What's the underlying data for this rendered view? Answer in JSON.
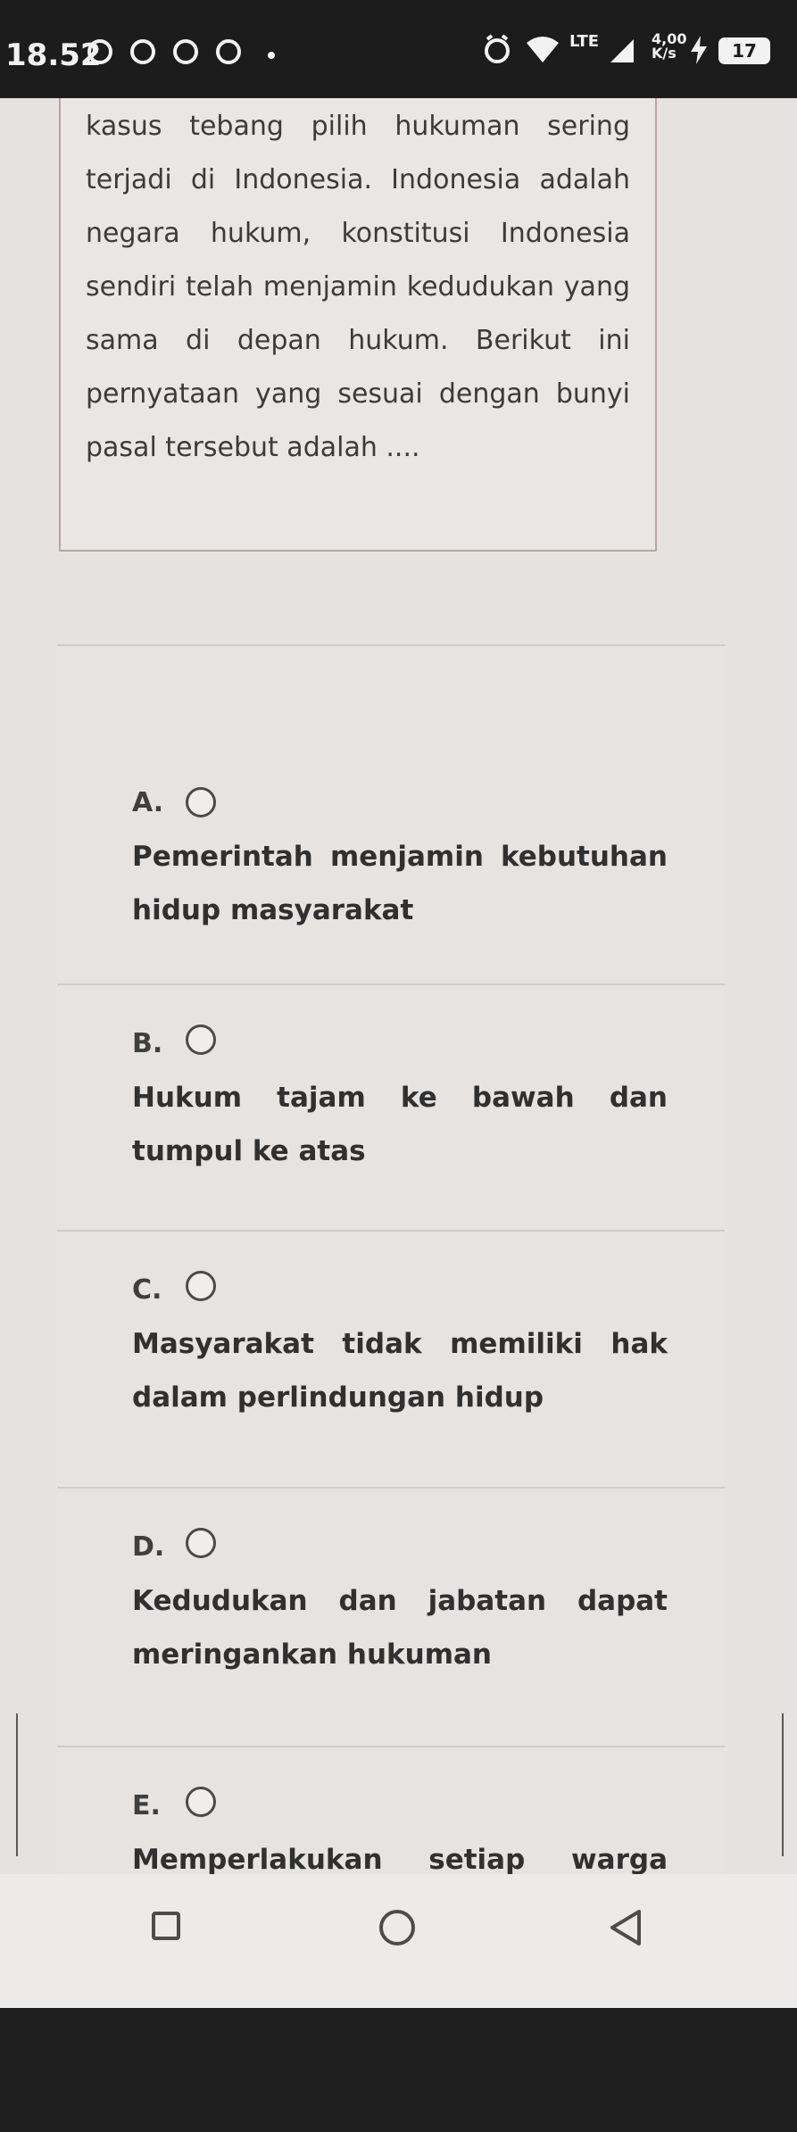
{
  "status_bar": {
    "time": "18.52",
    "battery": "17",
    "network_label": "LTE",
    "speed_label": "4,00\nK/s"
  },
  "question": {
    "text": "kasus tebang pilih hukuman sering terjadi di Indonesia. Indonesia adalah negara hukum, konstitusi Indonesia sendiri telah menjamin kedudukan yang sama di depan hukum. Berikut ini pernyataan yang sesuai dengan bunyi pasal tersebut adalah ...."
  },
  "options": [
    {
      "letter": "A.",
      "text": "Pemerintah menjamin kebutuhan hidup masyarakat"
    },
    {
      "letter": "B.",
      "text": "Hukum tajam ke bawah dan tumpul ke atas"
    },
    {
      "letter": "C.",
      "text": "Masyarakat tidak memiliki hak dalam perlindungan hidup"
    },
    {
      "letter": "D.",
      "text": "Kedudukan dan jabatan dapat meringankan hukuman"
    },
    {
      "letter": "E.",
      "text": "Memperlakukan setiap warga negara dengan sama"
    }
  ],
  "icons": {
    "recent_apps": "square-icon",
    "home": "circle-icon",
    "back": "triangle-back-icon"
  },
  "colors": {
    "status_bar": "#1c1c1c",
    "card_border": "#b7a5a2",
    "text": "#303030"
  }
}
